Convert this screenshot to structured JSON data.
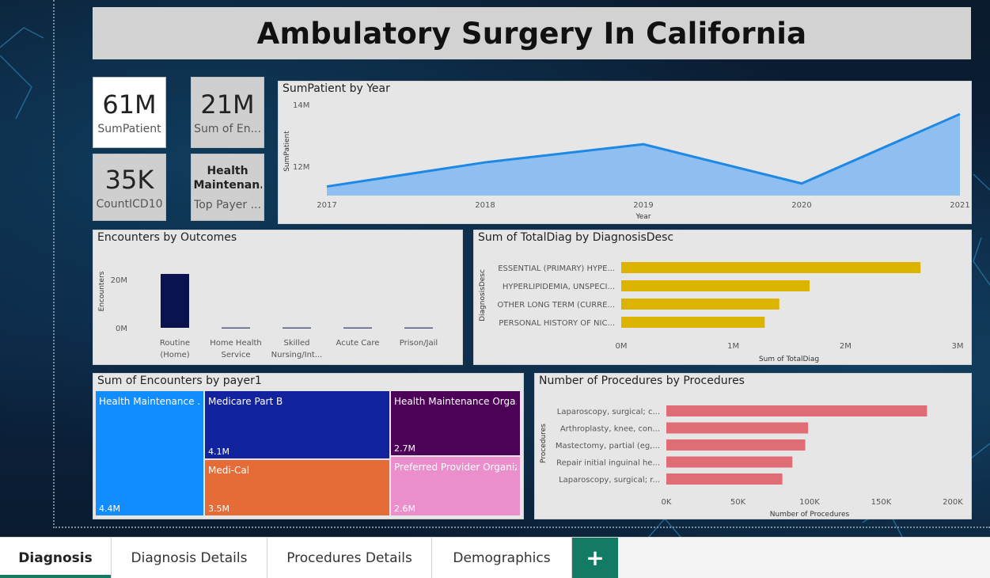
{
  "title": "Ambulatory Surgery In California",
  "kpis": {
    "sum_patient": {
      "value": "61M",
      "label": "SumPatient"
    },
    "sum_encounters": {
      "value": "21M",
      "label": "Sum of En..."
    },
    "count_icd10": {
      "value": "35K",
      "label": "CountICD10"
    },
    "top_payer": {
      "value_line1": "Health",
      "value_line2": "Maintenan...",
      "label": "Top Payer ..."
    }
  },
  "chart_data": [
    {
      "type": "area",
      "title": "SumPatient by Year",
      "xlabel": "Year",
      "ylabel": "SumPatient",
      "x": [
        "2017",
        "2018",
        "2019",
        "2020",
        "2021"
      ],
      "y_ticks": [
        "14M",
        "12M"
      ],
      "series": [
        {
          "values": [
            11.2,
            12.0,
            12.6,
            11.3,
            13.6
          ]
        }
      ],
      "ylim": [
        10.9,
        14.1
      ],
      "color": "#1e88e5",
      "fill": "#8fbef0"
    },
    {
      "type": "bar",
      "title": "Encounters by Outcomes",
      "xlabel": "",
      "ylabel": "Encounters",
      "categories": [
        [
          "Routine",
          "(Home)"
        ],
        [
          "Home Health",
          "Service"
        ],
        [
          "Skilled",
          "Nursing/Int..."
        ],
        [
          "Acute Care"
        ],
        [
          "Prison/Jail"
        ]
      ],
      "values": [
        20.5,
        0.1,
        0.1,
        0.1,
        0.1
      ],
      "y_ticks": [
        "20M",
        "0M"
      ],
      "ylim": [
        0,
        22
      ],
      "color": "#0b1250"
    },
    {
      "type": "bar",
      "orientation": "horizontal",
      "title": "Sum of TotalDiag by DiagnosisDesc",
      "xlabel": "Sum of TotalDiag",
      "ylabel": "DiagnosisDesc",
      "categories": [
        "ESSENTIAL (PRIMARY) HYPE...",
        "HYPERLIPIDEMIA, UNSPECI...",
        "OTHER LONG TERM (CURRE...",
        "PERSONAL HISTORY OF NIC..."
      ],
      "values": [
        2.67,
        1.68,
        1.41,
        1.28
      ],
      "x_ticks": [
        "0M",
        "1M",
        "2M",
        "3M"
      ],
      "xlim": [
        0,
        3
      ],
      "color": "#dcb400"
    },
    {
      "type": "treemap",
      "title": "Sum of Encounters by payer1",
      "items": [
        {
          "name": "Health Maintenance ...",
          "value": "4.4M",
          "color": "#118dff"
        },
        {
          "name": "Medicare Part B",
          "value": "4.1M",
          "color": "#12239e"
        },
        {
          "name": "Health Maintenance Orga...",
          "value": "2.7M",
          "color": "#4b0257"
        },
        {
          "name": "Medi-Cal",
          "value": "3.5M",
          "color": "#e66c37"
        },
        {
          "name": "Preferred Provider Organiz...",
          "value": "2.6M",
          "color": "#eb8fcc"
        }
      ]
    },
    {
      "type": "bar",
      "orientation": "horizontal",
      "title": "Number of Procedures by Procedures",
      "xlabel": "Number of Procedures",
      "ylabel": "Procedures",
      "categories": [
        "Laparoscopy, surgical; c...",
        "Arthroplasty, knee, con...",
        "Mastectomy, partial (eg,...",
        "Repair initial inguinal he...",
        "Laparoscopy, surgical; r..."
      ],
      "values": [
        182000,
        99000,
        97000,
        88000,
        81000
      ],
      "x_ticks": [
        "0K",
        "50K",
        "100K",
        "150K",
        "200K"
      ],
      "xlim": [
        0,
        200000
      ],
      "color": "#e06c75"
    }
  ],
  "tabs": [
    {
      "label": "Diagnosis",
      "active": true
    },
    {
      "label": "Diagnosis Details",
      "active": false
    },
    {
      "label": "Procedures Details",
      "active": false
    },
    {
      "label": "Demographics",
      "active": false
    }
  ],
  "add_tab_label": "+"
}
